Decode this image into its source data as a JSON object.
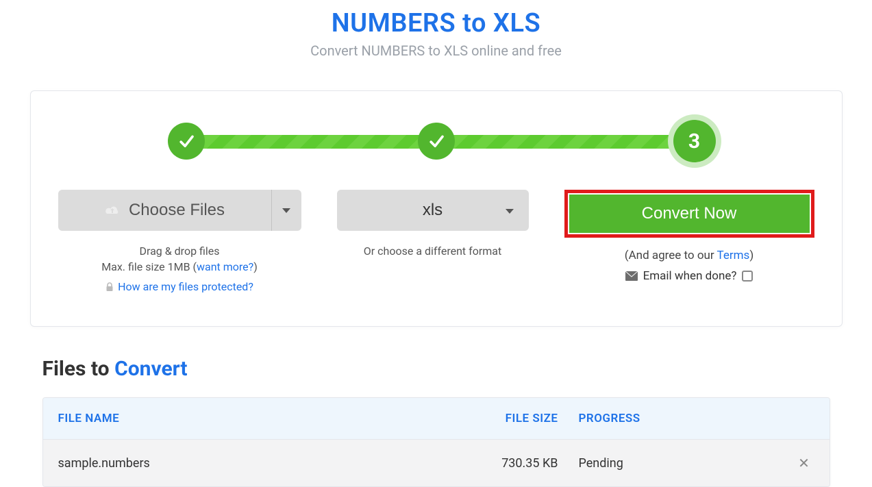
{
  "header": {
    "title": "NUMBERS to XLS",
    "subtitle": "Convert NUMBERS to XLS online and free"
  },
  "stepper": {
    "step1_done": true,
    "step2_done": true,
    "active_step_number": "3"
  },
  "choose": {
    "button_label": "Choose Files",
    "hint1": "Drag & drop files",
    "hint2_prefix": "Max. file size 1MB (",
    "hint2_link": "want more?",
    "hint2_suffix": ")",
    "protected_link": "How are my files protected?"
  },
  "format": {
    "selected": "xls",
    "hint": "Or choose a different format"
  },
  "convert": {
    "button_label": "Convert Now",
    "agree_prefix": "(And agree to our ",
    "agree_link": "Terms",
    "agree_suffix": ")",
    "email_label": "Email when done?",
    "email_checked": false
  },
  "files": {
    "section_title_prefix": "Files to ",
    "section_title_accent": "Convert",
    "headers": {
      "name": "FILE NAME",
      "size": "FILE SIZE",
      "progress": "PROGRESS"
    },
    "rows": [
      {
        "name": "sample.numbers",
        "size": "730.35 KB",
        "progress": "Pending"
      }
    ]
  }
}
